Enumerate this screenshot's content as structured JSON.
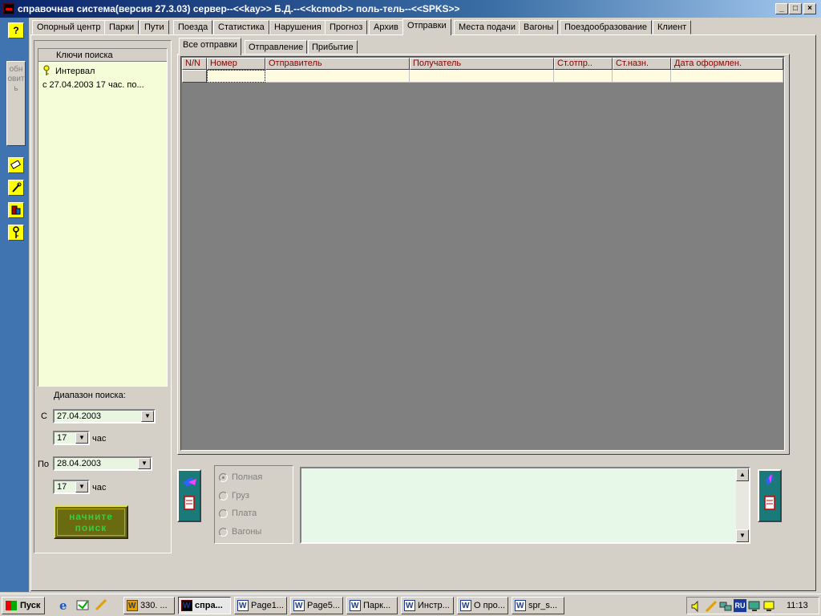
{
  "window": {
    "title": "справочная система(версия 27.3.03) сервер--<<kay>> Б.Д.--<<kcmod>> поль-тель--<<SPKS>>"
  },
  "leftstrip": {
    "refresh_label": "обновить",
    "help_label": "?"
  },
  "tabs": [
    "Опорный центр",
    "Парки",
    "Пути",
    "Поезда",
    "Статистика",
    "Нарушения",
    "Прогноз",
    "Архив",
    "Отправки",
    "Места подачи",
    "Вагоны",
    "Поездообразование",
    "Клиент"
  ],
  "search_keys": {
    "header": "Ключи поиска",
    "item_label": "Интервал",
    "item_value": "с 27.04.2003   17 час.  по..."
  },
  "range": {
    "label": "Диапазон поиска:",
    "from_label": "С",
    "from_date": "27.04.2003",
    "from_hour": "17",
    "to_label": "По",
    "to_date": "28.04.2003",
    "to_hour": "17",
    "hour_unit": "час"
  },
  "search_button": {
    "line1": "начните",
    "line2": "поиск"
  },
  "subtabs": [
    "Все отправки",
    "Отправление",
    "Прибытие"
  ],
  "grid": {
    "columns": [
      "N/N",
      "Номер",
      "Отправитель",
      "Получатель",
      "Ст.отпр..",
      "Ст.назн.",
      "Дата оформлен."
    ]
  },
  "radio_options": [
    "Полная",
    "Груз",
    "Плата",
    "Вагоны"
  ],
  "taskbar": {
    "start_label": "Пуск",
    "buttons": [
      "330. ...",
      "спра...",
      "Page1...",
      "Page5...",
      "Парк...",
      "Инстр...",
      "О про...",
      "spr_s..."
    ],
    "clock": "11:13",
    "lang": "RU"
  },
  "colors": {
    "titlebar_start": "#0a246a",
    "strip_blue": "#3f74b0",
    "grid_bg": "#808080",
    "header_text": "#8b0000",
    "button_green_text": "#30d040"
  }
}
